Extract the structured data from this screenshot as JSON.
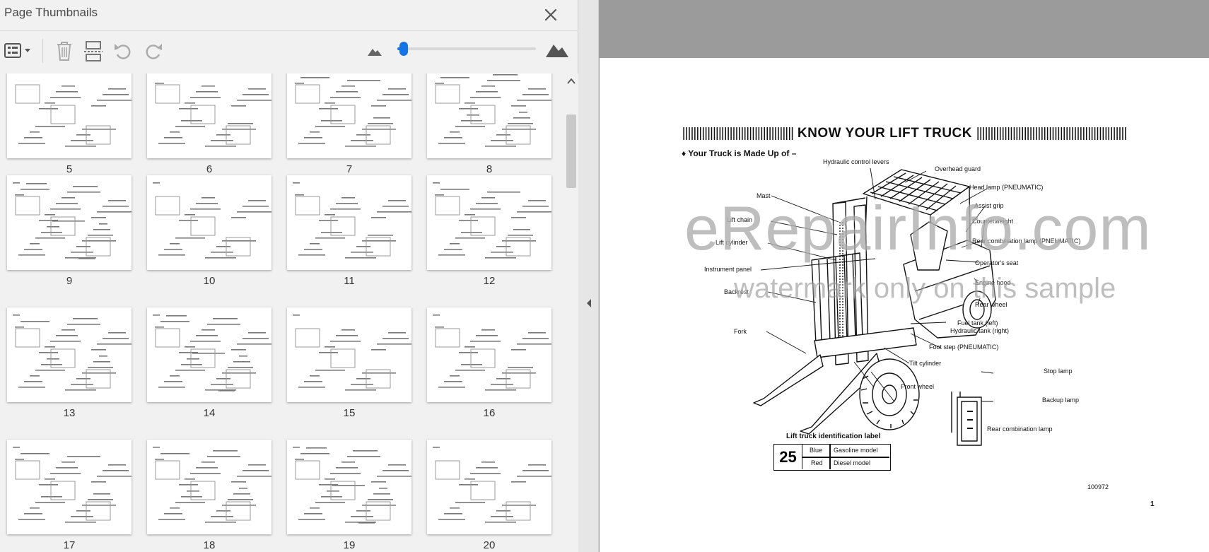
{
  "panel": {
    "title": "Page Thumbnails",
    "close_icon": "close-icon"
  },
  "toolbar": {
    "items": [
      "options-menu-icon",
      "delete-icon",
      "extract-pages-icon",
      "rotate-counterclockwise-icon",
      "rotate-clockwise-icon"
    ],
    "zoom": {
      "min_icon": "mountain-small-icon",
      "max_icon": "mountain-large-icon",
      "level": 0.03
    }
  },
  "thumbnails": [
    {
      "page": "5"
    },
    {
      "page": "6"
    },
    {
      "page": "7"
    },
    {
      "page": "8"
    },
    {
      "page": "9"
    },
    {
      "page": "10"
    },
    {
      "page": "11"
    },
    {
      "page": "12"
    },
    {
      "page": "13"
    },
    {
      "page": "14"
    },
    {
      "page": "15"
    },
    {
      "page": "16"
    },
    {
      "page": "17"
    },
    {
      "page": "18"
    },
    {
      "page": "19"
    },
    {
      "page": "20"
    }
  ],
  "colors": {
    "accent": "#1473e6",
    "panel_bg": "#f1f1f1",
    "viewer_bg": "#9b9b9b"
  },
  "document": {
    "title": "KNOW YOUR LIFT TRUCK",
    "subtitle": "♦  Your Truck is Made Up of –",
    "labels": {
      "hydraulic_control_levers": "Hydraulic control levers",
      "overhead_guard": "Overhead guard",
      "head_lamp": "Head lamp (PNEUMATIC)",
      "mast": "Mast",
      "assist_grip": "Assist grip",
      "lift_chain": "Lift chain",
      "counterweight": "Counterweight",
      "rear_combination_lamp_pneumatic": "Rear combination lamp (PNEUMATIC)",
      "lift_cylinder": "Lift cylinder",
      "operators_seat": "Operator's seat",
      "instrument_panel": "Instrument panel",
      "engine_hood": "Engine hood",
      "backrest": "Backrest",
      "rear_wheel": "Rear wheel",
      "fuel_tank": "Fuel tank (left)",
      "hydraulic_tank": "Hydraulic tank (right)",
      "fork": "Fork",
      "foot_step": "Foot step (PNEUMATIC)",
      "tilt_cylinder": "Tilt cylinder",
      "front_wheel": "Front wheel",
      "stop_lamp": "Stop lamp",
      "backup_lamp": "Backup lamp",
      "rear_combination_lamp": "Rear combination lamp"
    },
    "id_label": {
      "title": "Lift truck identification label",
      "number": "25",
      "row1_color": "Blue",
      "row1_model": "Gasoline model",
      "row2_color": "Red",
      "row2_model": "Diesel model"
    },
    "code": "100972",
    "page_number": "1",
    "watermark_main": "eRepairInfo.com",
    "watermark_sub": "watermark only on this sample"
  },
  "divider": {
    "collapse_icon": "collapse-left-arrow-icon"
  }
}
